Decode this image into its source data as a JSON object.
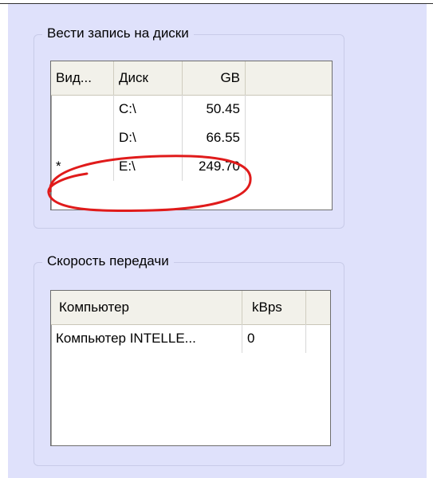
{
  "groups": {
    "disks": {
      "title": "Вести запись на диски",
      "columns": [
        "Вид...",
        "Диск",
        "GB"
      ],
      "rows": [
        {
          "kind": "",
          "disk": "C:\\",
          "gb": "50.45"
        },
        {
          "kind": "",
          "disk": "D:\\",
          "gb": "66.55"
        },
        {
          "kind": "*",
          "disk": "E:\\",
          "gb": "249.70"
        }
      ],
      "highlight_color": "#e01b1b"
    },
    "speed": {
      "title": "Скорость передачи",
      "columns": [
        "Компьютер",
        "kBps"
      ],
      "rows": [
        {
          "computer": "Компьютер INTELLE...",
          "kbps": "0"
        }
      ]
    }
  },
  "colors": {
    "panel_bg": "#dfe1fb",
    "header_bg": "#f2f1ea",
    "highlight": "#e01b1b"
  }
}
